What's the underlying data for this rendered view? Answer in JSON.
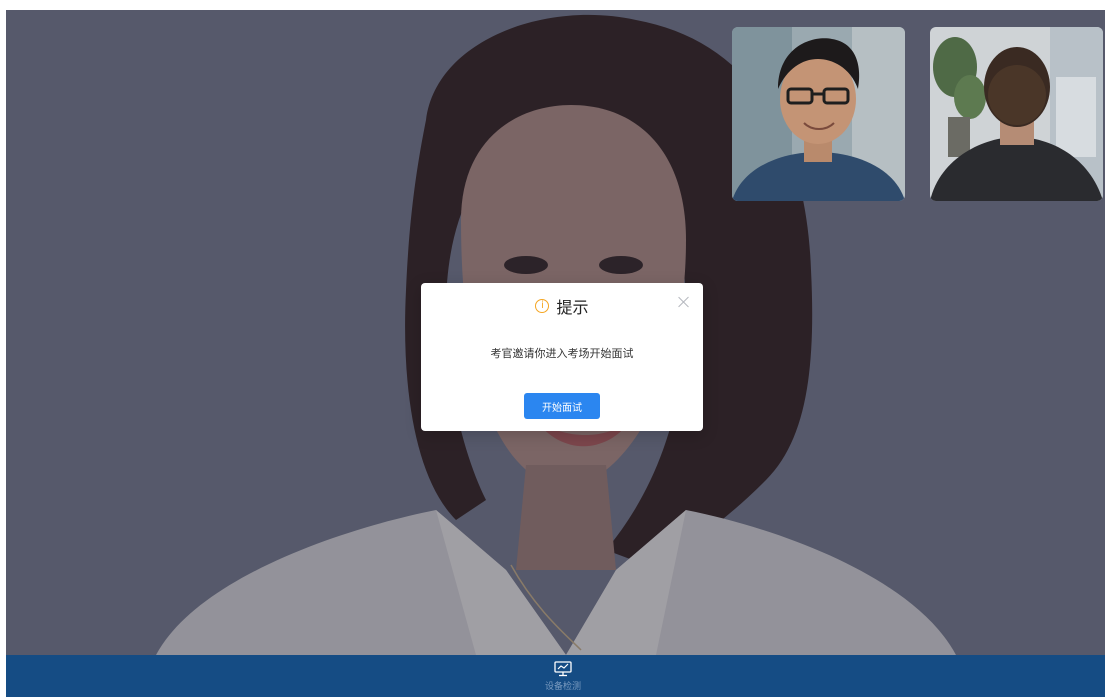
{
  "main_video": {
    "participant_icon": "candidate-video"
  },
  "thumbnails": [
    {
      "icon": "examiner-video-front"
    },
    {
      "icon": "examiner-video-back"
    }
  ],
  "dialog": {
    "icon": "info-icon",
    "title": "提示",
    "message": "考官邀请你进入考场开始面试",
    "button_label": "开始面试",
    "close_icon": "close-icon"
  },
  "bottom_bar": {
    "device_check_label": "设备检测",
    "device_check_icon": "monitor-icon"
  },
  "colors": {
    "primary_button": "#2b86f0",
    "bottom_bar": "#154c84",
    "info_icon": "#f5a623",
    "stage_background": "#575b6c"
  }
}
